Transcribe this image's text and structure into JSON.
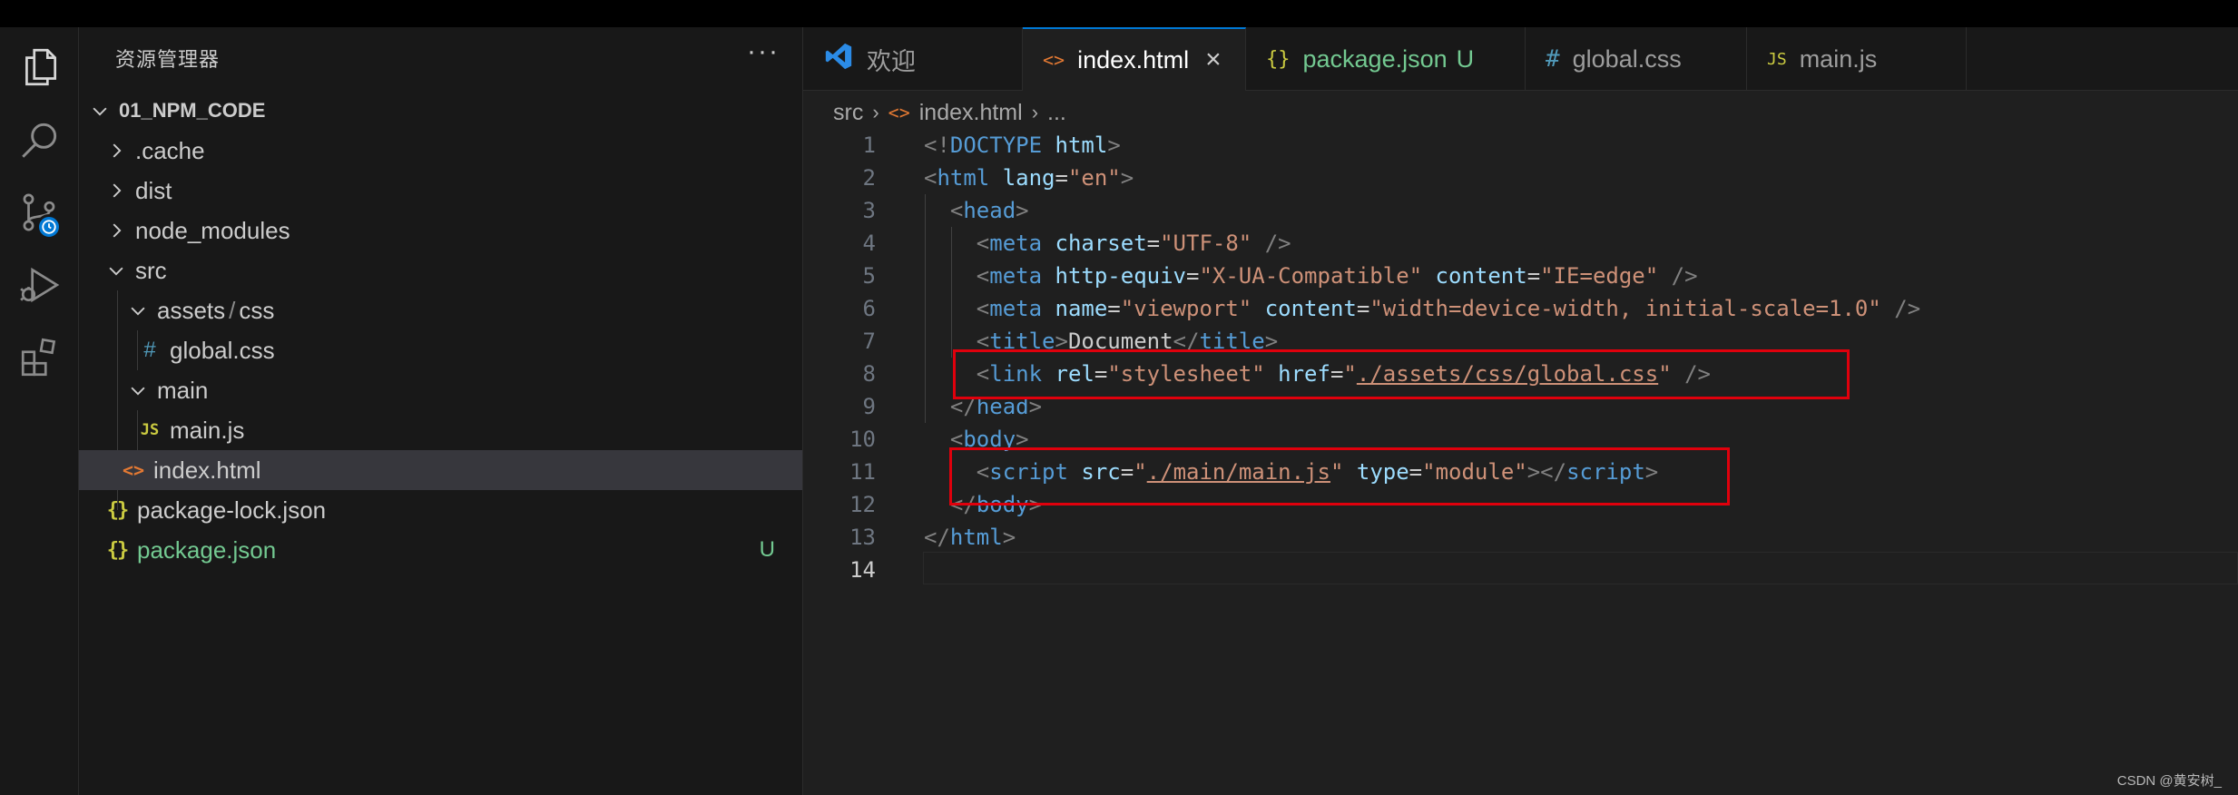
{
  "explorer": {
    "title": "资源管理器",
    "more": "···",
    "root": "01_NPM_CODE",
    "items": [
      {
        "label": ".cache"
      },
      {
        "label": "dist"
      },
      {
        "label": "node_modules"
      },
      {
        "label": "src"
      },
      {
        "label": "assets",
        "sep": "/",
        "label2": "css"
      },
      {
        "label": "global.css",
        "icon": "#"
      },
      {
        "label": "main"
      },
      {
        "label": "main.js",
        "icon": "JS"
      },
      {
        "label": "index.html",
        "icon": "<>"
      },
      {
        "label": "package-lock.json",
        "icon": "{}"
      },
      {
        "label": "package.json",
        "icon": "{}",
        "badge": "U"
      }
    ]
  },
  "tabs": [
    {
      "label": "欢迎"
    },
    {
      "label": "index.html",
      "icon": "<>",
      "close": "×"
    },
    {
      "label": "package.json",
      "icon": "{}",
      "status": "U"
    },
    {
      "label": "global.css",
      "icon": "#"
    },
    {
      "label": "main.js",
      "icon": "JS"
    }
  ],
  "breadcrumb": {
    "part1": "src",
    "part2": "index.html",
    "part3": "...",
    "sep": "›",
    "icon": "<>"
  },
  "editor": {
    "line_numbers": [
      "1",
      "2",
      "3",
      "4",
      "5",
      "6",
      "7",
      "8",
      "9",
      "10",
      "11",
      "12",
      "13",
      "14"
    ],
    "current_line": "14",
    "lines": [
      [
        [
          "p",
          "<!"
        ],
        [
          "t",
          "DOCTYPE"
        ],
        [
          "x",
          " "
        ],
        [
          "a",
          "html"
        ],
        [
          "p",
          ">"
        ]
      ],
      [
        [
          "p",
          "<"
        ],
        [
          "t",
          "html"
        ],
        [
          "x",
          " "
        ],
        [
          "a",
          "lang"
        ],
        [
          "x",
          "="
        ],
        [
          "s",
          "\"en\""
        ],
        [
          "p",
          ">"
        ]
      ],
      [
        [
          "x",
          "  "
        ],
        [
          "p",
          "<"
        ],
        [
          "t",
          "head"
        ],
        [
          "p",
          ">"
        ]
      ],
      [
        [
          "x",
          "    "
        ],
        [
          "p",
          "<"
        ],
        [
          "t",
          "meta"
        ],
        [
          "x",
          " "
        ],
        [
          "a",
          "charset"
        ],
        [
          "x",
          "="
        ],
        [
          "s",
          "\"UTF-8\""
        ],
        [
          "x",
          " "
        ],
        [
          "p",
          "/>"
        ]
      ],
      [
        [
          "x",
          "    "
        ],
        [
          "p",
          "<"
        ],
        [
          "t",
          "meta"
        ],
        [
          "x",
          " "
        ],
        [
          "a",
          "http-equiv"
        ],
        [
          "x",
          "="
        ],
        [
          "s",
          "\"X-UA-Compatible\""
        ],
        [
          "x",
          " "
        ],
        [
          "a",
          "content"
        ],
        [
          "x",
          "="
        ],
        [
          "s",
          "\"IE=edge\""
        ],
        [
          "x",
          " "
        ],
        [
          "p",
          "/>"
        ]
      ],
      [
        [
          "x",
          "    "
        ],
        [
          "p",
          "<"
        ],
        [
          "t",
          "meta"
        ],
        [
          "x",
          " "
        ],
        [
          "a",
          "name"
        ],
        [
          "x",
          "="
        ],
        [
          "s",
          "\"viewport\""
        ],
        [
          "x",
          " "
        ],
        [
          "a",
          "content"
        ],
        [
          "x",
          "="
        ],
        [
          "s",
          "\"width=device-width, initial-scale=1.0\""
        ],
        [
          "x",
          " "
        ],
        [
          "p",
          "/>"
        ]
      ],
      [
        [
          "x",
          "    "
        ],
        [
          "p",
          "<"
        ],
        [
          "t",
          "title"
        ],
        [
          "p",
          ">"
        ],
        [
          "x",
          "Document"
        ],
        [
          "p",
          "</"
        ],
        [
          "t",
          "title"
        ],
        [
          "p",
          ">"
        ]
      ],
      [
        [
          "x",
          "    "
        ],
        [
          "p",
          "<"
        ],
        [
          "t",
          "link"
        ],
        [
          "x",
          " "
        ],
        [
          "a",
          "rel"
        ],
        [
          "x",
          "="
        ],
        [
          "s",
          "\"stylesheet\""
        ],
        [
          "x",
          " "
        ],
        [
          "a",
          "href"
        ],
        [
          "x",
          "="
        ],
        [
          "s",
          "\""
        ],
        [
          "u",
          "./assets/css/global.css"
        ],
        [
          "s",
          "\""
        ],
        [
          "x",
          " "
        ],
        [
          "p",
          "/>"
        ]
      ],
      [
        [
          "x",
          "  "
        ],
        [
          "p",
          "</"
        ],
        [
          "t",
          "head"
        ],
        [
          "p",
          ">"
        ]
      ],
      [
        [
          "x",
          "  "
        ],
        [
          "p",
          "<"
        ],
        [
          "t",
          "body"
        ],
        [
          "p",
          ">"
        ]
      ],
      [
        [
          "x",
          "    "
        ],
        [
          "p",
          "<"
        ],
        [
          "t",
          "script"
        ],
        [
          "x",
          " "
        ],
        [
          "a",
          "src"
        ],
        [
          "x",
          "="
        ],
        [
          "s",
          "\""
        ],
        [
          "u",
          "./main/main.js"
        ],
        [
          "s",
          "\""
        ],
        [
          "x",
          " "
        ],
        [
          "a",
          "type"
        ],
        [
          "x",
          "="
        ],
        [
          "s",
          "\"module\""
        ],
        [
          "p",
          "></"
        ],
        [
          "t",
          "script"
        ],
        [
          "p",
          ">"
        ]
      ],
      [
        [
          "x",
          "  "
        ],
        [
          "p",
          "</"
        ],
        [
          "t",
          "body"
        ],
        [
          "p",
          ">"
        ]
      ],
      [
        [
          "p",
          "</"
        ],
        [
          "t",
          "html"
        ],
        [
          "p",
          ">"
        ]
      ],
      []
    ]
  },
  "colors": {
    "highlight_box": "#e0000c",
    "accent": "#0078d4",
    "untracked": "#73c991"
  },
  "watermark": "CSDN @黄安树_"
}
